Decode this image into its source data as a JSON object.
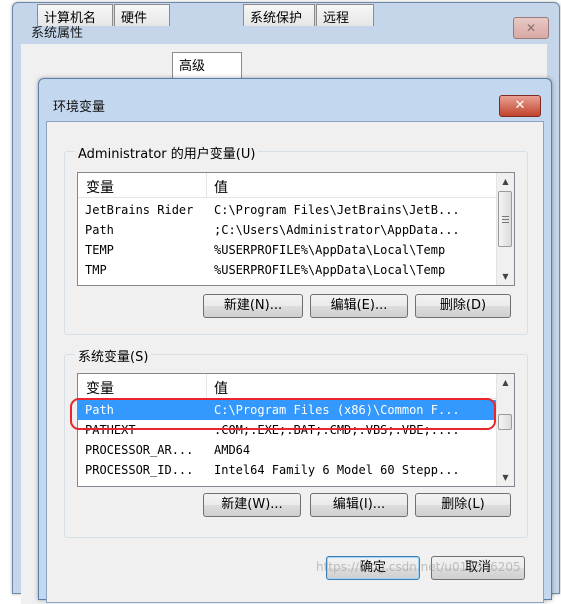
{
  "outer_window": {
    "title": "系统属性",
    "tabs": [
      "计算机名",
      "硬件",
      "高级",
      "系统保护",
      "远程"
    ],
    "active_tab": "高级"
  },
  "dialog": {
    "title": "环境变量",
    "close_glyph": "✕",
    "user_group": {
      "legend": "Administrator 的用户变量(U)",
      "columns": [
        "变量",
        "值"
      ],
      "rows": [
        {
          "name": "JetBrains Rider",
          "value": "C:\\Program Files\\JetBrains\\JetB..."
        },
        {
          "name": "Path",
          "value": ";C:\\Users\\Administrator\\AppData..."
        },
        {
          "name": "TEMP",
          "value": "%USERPROFILE%\\AppData\\Local\\Temp"
        },
        {
          "name": "TMP",
          "value": "%USERPROFILE%\\AppData\\Local\\Temp"
        }
      ],
      "buttons": {
        "new": "新建(N)...",
        "edit": "编辑(E)...",
        "delete": "删除(D)"
      }
    },
    "system_group": {
      "legend": "系统变量(S)",
      "columns": [
        "变量",
        "值"
      ],
      "rows": [
        {
          "name": "Path",
          "value": "C:\\Program Files (x86)\\Common F...",
          "selected": true
        },
        {
          "name": "PATHEXT",
          "value": ".COM;.EXE;.BAT;.CMD;.VBS;.VBE;...."
        },
        {
          "name": "PROCESSOR_AR...",
          "value": "AMD64"
        },
        {
          "name": "PROCESSOR_ID...",
          "value": "Intel64 Family 6 Model 60 Stepp..."
        }
      ],
      "buttons": {
        "new": "新建(W)...",
        "edit": "编辑(I)...",
        "delete": "删除(L)"
      }
    },
    "ok_label": "确定",
    "cancel_label": "取消"
  },
  "watermark": "https://blog.csdn.net/u013346205",
  "colors": {
    "selection": "#3399ff",
    "highlight_ring": "#e8262b",
    "close_button": "#c2432d"
  }
}
